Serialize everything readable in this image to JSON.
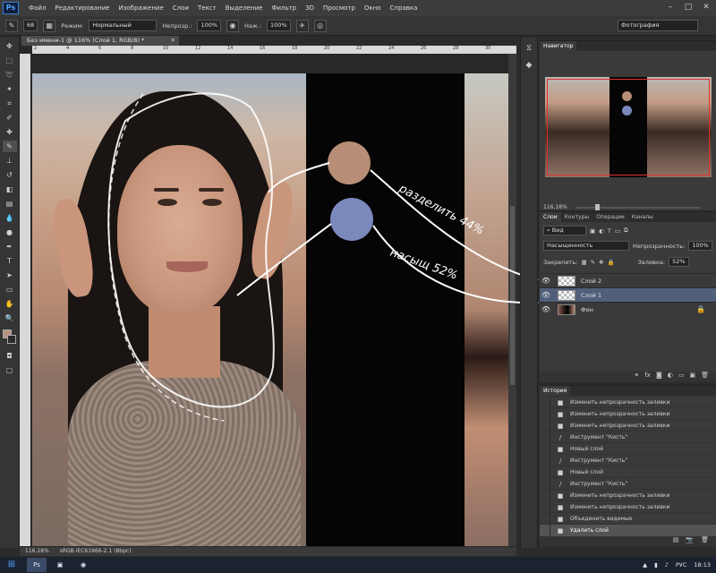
{
  "app": {
    "logo": "Ps",
    "menu": [
      "Файл",
      "Редактирование",
      "Изображение",
      "Слои",
      "Текст",
      "Выделение",
      "Фильтр",
      "3D",
      "Просмотр",
      "Окно",
      "Справка"
    ]
  },
  "options": {
    "brush_size": "68",
    "mode_label": "Режим:",
    "mode_value": "Нормальный",
    "opacity_label": "Непрозр.:",
    "opacity_value": "100%",
    "pressure_label": "Наж.:",
    "pressure_value": "100%",
    "workspace": "Фотография"
  },
  "document": {
    "tab_title": "Без имени-1 @ 116% (Слой 1, RGB/8) *",
    "ruler_ticks": [
      "2",
      "4",
      "6",
      "8",
      "10",
      "12",
      "14",
      "16",
      "18",
      "20",
      "22",
      "24",
      "26",
      "28",
      "30"
    ]
  },
  "annotations": {
    "text1": "разделить 44%",
    "text2": "насыщ 52%",
    "swatch1_color": "#b78d76",
    "swatch2_color": "#7b88bc"
  },
  "status": {
    "zoom": "116,18%",
    "profile": "sRGB IEC61966-2.1 (8bpc)"
  },
  "navigator": {
    "tab": "Навигатор",
    "zoom": "116,18%"
  },
  "layers": {
    "tabs": [
      "Слои",
      "Контуры",
      "Операции",
      "Каналы"
    ],
    "filter": "Вид",
    "blend_mode": "Насыщенность",
    "opacity_label": "Непрозрачность:",
    "opacity_value": "100%",
    "lock_label": "Закрепить:",
    "fill_label": "Заливка:",
    "fill_value": "52%",
    "items": [
      {
        "name": "Слой 2"
      },
      {
        "name": "Слой 1"
      },
      {
        "name": "Фон"
      }
    ]
  },
  "history": {
    "tab": "История",
    "items": [
      {
        "label": "Изменить непрозрачность заливки",
        "icon": "■"
      },
      {
        "label": "Изменить непрозрачность заливки",
        "icon": "■"
      },
      {
        "label": "Изменить непрозрачность заливки",
        "icon": "■"
      },
      {
        "label": "Инструмент \"Кисть\"",
        "icon": "/"
      },
      {
        "label": "Новый слой",
        "icon": "■"
      },
      {
        "label": "Инструмент \"Кисть\"",
        "icon": "/"
      },
      {
        "label": "Новый слой",
        "icon": "■"
      },
      {
        "label": "Инструмент \"Кисть\"",
        "icon": "/"
      },
      {
        "label": "Изменить непрозрачность заливки",
        "icon": "■"
      },
      {
        "label": "Изменить непрозрачность заливки",
        "icon": "■"
      },
      {
        "label": "Объединить видимые",
        "icon": "■"
      },
      {
        "label": "Удалить слой",
        "icon": "■"
      }
    ]
  },
  "taskbar": {
    "lang": "РУС",
    "time": "18:13"
  }
}
